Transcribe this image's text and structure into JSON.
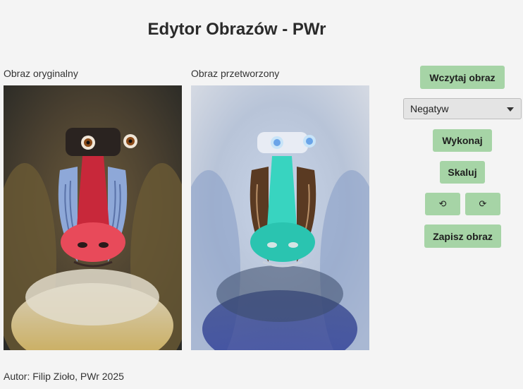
{
  "window": {
    "title": "Edytor Obrazów - PWr"
  },
  "panels": {
    "original_label": "Obraz oryginalny",
    "processed_label": "Obraz przetworzony"
  },
  "controls": {
    "load_button": "Wczytaj obraz",
    "operation_select": {
      "selected": "Negatyw"
    },
    "execute_button": "Wykonaj",
    "scale_button": "Skaluj",
    "rotate_left_glyph": "⟲",
    "rotate_right_glyph": "⟳",
    "save_button": "Zapisz obraz",
    "accent_color": "#a6d4a6"
  },
  "footer": {
    "text": "Autor: Filip Zioło, PWr 2025"
  }
}
